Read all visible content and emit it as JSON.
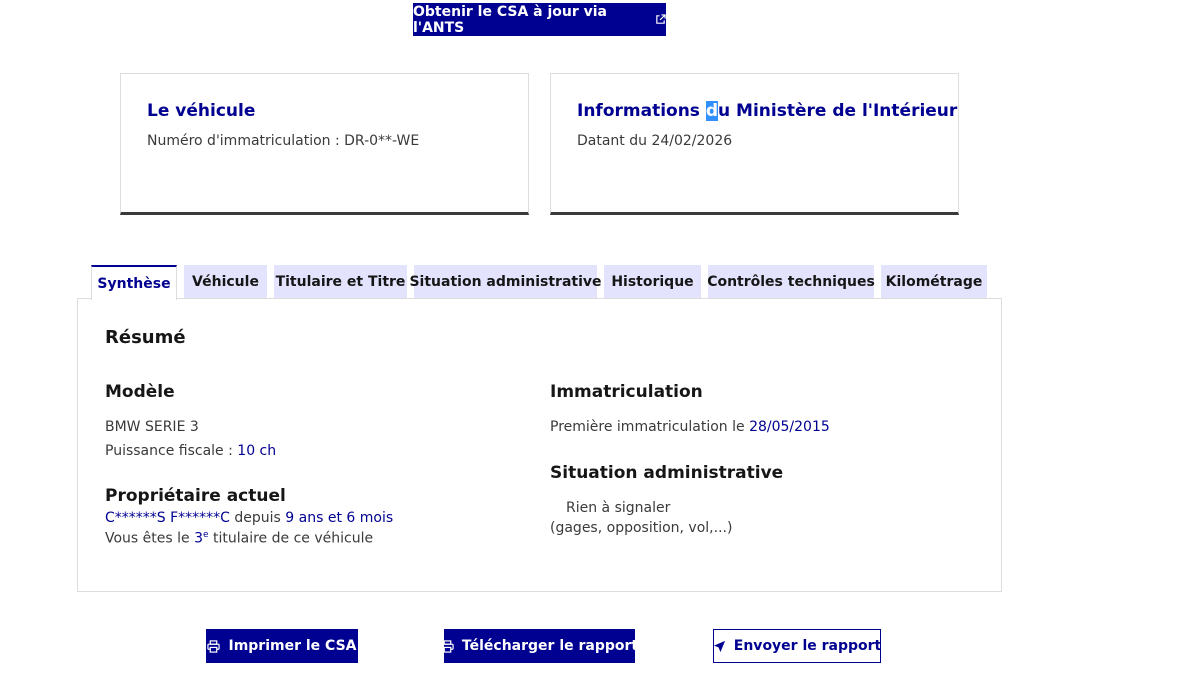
{
  "top_button": {
    "label": "Obtenir le CSA à jour via l'ANTS",
    "icon": "external-link-icon"
  },
  "vehicle_card": {
    "title": "Le véhicule",
    "plate_label": "Numéro d'immatriculation : ",
    "plate_value": "DR-0**-WE"
  },
  "ministry_card": {
    "title_start": "Informations ",
    "title_highlight": "d",
    "title_end": "u Ministère de l'Intérieur",
    "date_text": "Datant du 24/02/2026"
  },
  "tabs": [
    {
      "label": "Synthèse",
      "active": true
    },
    {
      "label": "Véhicule"
    },
    {
      "label": "Titulaire et Titre"
    },
    {
      "label": "Situation administrative"
    },
    {
      "label": "Historique"
    },
    {
      "label": "Contrôles techniques"
    },
    {
      "label": "Kilométrage"
    }
  ],
  "summary": {
    "heading": "Résumé",
    "model": {
      "heading": "Modèle",
      "name": "BMW SERIE 3",
      "power_label": "Puissance fiscale : ",
      "power_value": "10 ch"
    },
    "owner": {
      "heading": "Propriétaire actuel",
      "name": "C******S F******C",
      "since_label": " depuis ",
      "since_value": "9 ans et 6 mois",
      "rank_prefix": "Vous êtes le ",
      "rank_number": "3",
      "rank_suffix": "e",
      "rank_rest": " titulaire de ce véhicule"
    },
    "registration": {
      "heading": "Immatriculation",
      "first_label": "Première immatriculation le ",
      "first_date": "28/05/2015"
    },
    "admin": {
      "heading": "Situation administrative",
      "status": "Rien à signaler",
      "detail": "(gages, opposition, vol,...)"
    }
  },
  "actions": {
    "print": {
      "label": "Imprimer le CSA",
      "icon": "printer-icon"
    },
    "download": {
      "label": "Télécharger le rapport",
      "icon": "printer-icon"
    },
    "send": {
      "label": "Envoyer le rapport",
      "icon": "send-icon"
    }
  },
  "colors": {
    "primary": "#000091",
    "tab_bg": "#e3e3fd",
    "text": "#3a3a3a",
    "heading": "#161616",
    "highlight": "#3390ff"
  }
}
